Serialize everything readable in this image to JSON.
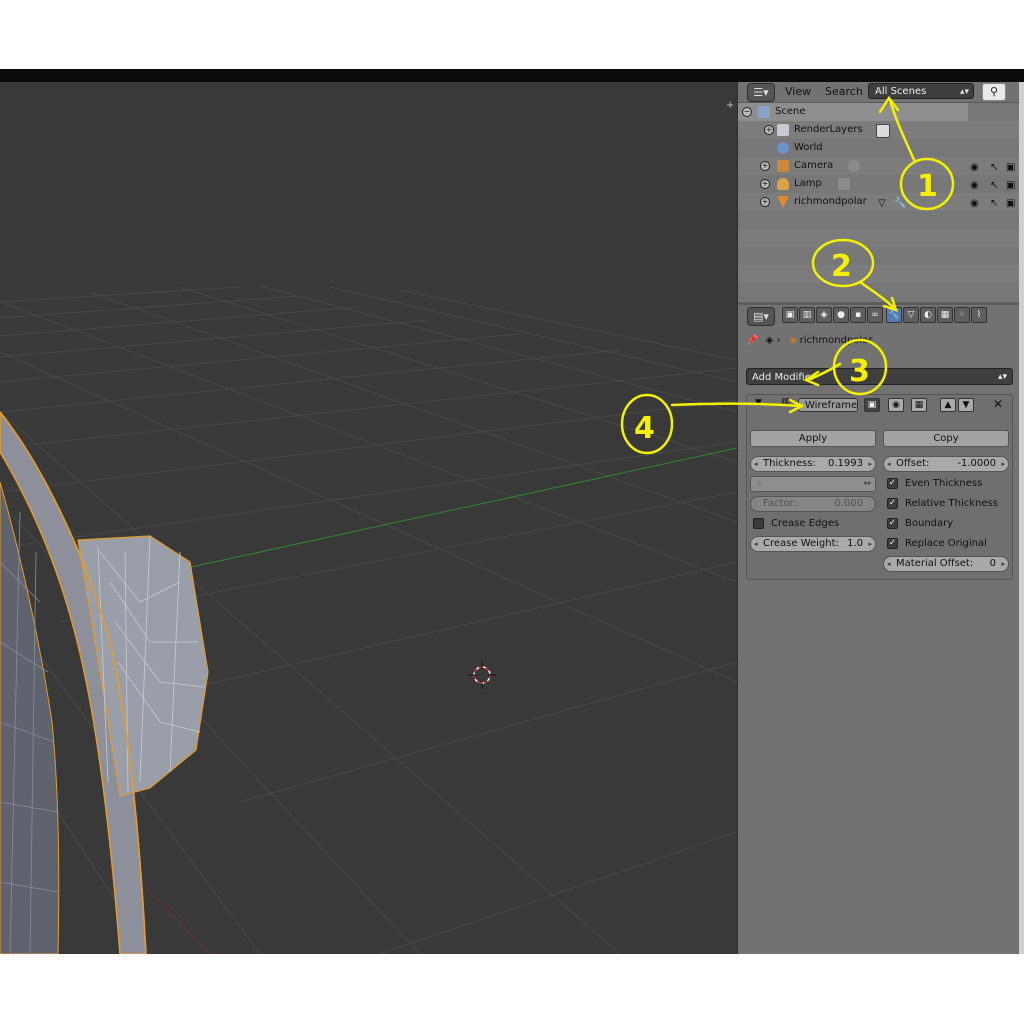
{
  "outliner": {
    "menus": {
      "view": "View",
      "search": "Search"
    },
    "scene_filter": "All Scenes",
    "rows": [
      {
        "label": "Scene"
      },
      {
        "label": "RenderLayers"
      },
      {
        "label": "World"
      },
      {
        "label": "Camera"
      },
      {
        "label": "Lamp"
      },
      {
        "label": "richmondpolar"
      }
    ]
  },
  "properties": {
    "breadcrumb": "richmondpolar",
    "add_modifier": "Add Modifier",
    "modifier": {
      "name": "Wireframe",
      "apply_label": "Apply",
      "copy_label": "Copy",
      "thickness": {
        "label": "Thickness:",
        "value": "0.1993"
      },
      "offset": {
        "label": "Offset:",
        "value": "-1.0000"
      },
      "factor": {
        "label": "Factor:",
        "value": "0.000"
      },
      "crease_weight": {
        "label": "Crease Weight:",
        "value": "1.0"
      },
      "material_offset": {
        "label": "Material Offset:",
        "value": "0"
      },
      "checkboxes": {
        "even_thickness": {
          "label": "Even Thickness",
          "checked": true
        },
        "relative_thickness": {
          "label": "Relative Thickness",
          "checked": true
        },
        "boundary": {
          "label": "Boundary",
          "checked": true
        },
        "replace_original": {
          "label": "Replace Original",
          "checked": true
        },
        "crease_edges": {
          "label": "Crease Edges",
          "checked": false
        }
      }
    }
  },
  "annotations": {
    "a1": "1",
    "a2": "2",
    "a3": "3",
    "a4": "4",
    "color": "#f5f000"
  },
  "colors": {
    "viewport_bg": "#393939",
    "panel_bg": "#727272",
    "selection_orange": "#e59a2c",
    "active_tab": "#5679b8"
  }
}
